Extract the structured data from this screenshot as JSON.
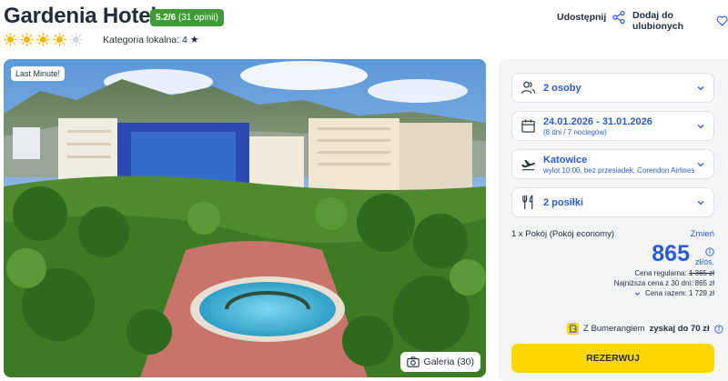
{
  "hotel": {
    "name": "Gardenia Hotel",
    "rating": "5.2/6",
    "opinions": "(31 opinii)",
    "category_label": "Kategoria lokalna: 4",
    "category_star": "★",
    "sun_rating": 4,
    "sun_max": 5
  },
  "actions": {
    "share_label": "Udostępnij",
    "favorite_label": "Dodaj do ulubionych"
  },
  "photo": {
    "badge": "Last Minute!",
    "gallery_label": "Galeria (30)"
  },
  "booking": {
    "persons": "2 osoby",
    "dates": "24.01.2026 - 31.01.2026",
    "dates_sub": "(8 dni / 7 noclegów)",
    "departure": "Katowice",
    "departure_sub": "wylot 10:00, bez przesiadek, Corendon Airlines",
    "meals": "2 posiłki",
    "room": "1 x Pokój  (Pokój economy)",
    "change_label": "Zmień",
    "price": "865",
    "price_unit": "zł/os.",
    "regular_price_label": "Cena regularna:",
    "regular_price": "1 365 zł",
    "lowest_30_days": "Najniższa cena z 30 dni: 865 zł",
    "total_label": "Cena razem: 1 729 zł",
    "boomerang_prefix": "Z Bumerangiem",
    "boomerang_bold": "zyskaj do 70 zł",
    "book_label": "REZERWUJ"
  },
  "colors": {
    "accent_blue": "#2a5ad7",
    "rating_green": "#3f9c35",
    "book_yellow": "#ffd600",
    "sun_yellow": "#f5b800"
  },
  "icons": [
    "sun-icon",
    "share-icon",
    "heart-icon",
    "camera-icon",
    "people-icon",
    "calendar-icon",
    "plane-icon",
    "cutlery-icon",
    "chevron-down-icon",
    "info-icon",
    "boomerang-icon"
  ]
}
